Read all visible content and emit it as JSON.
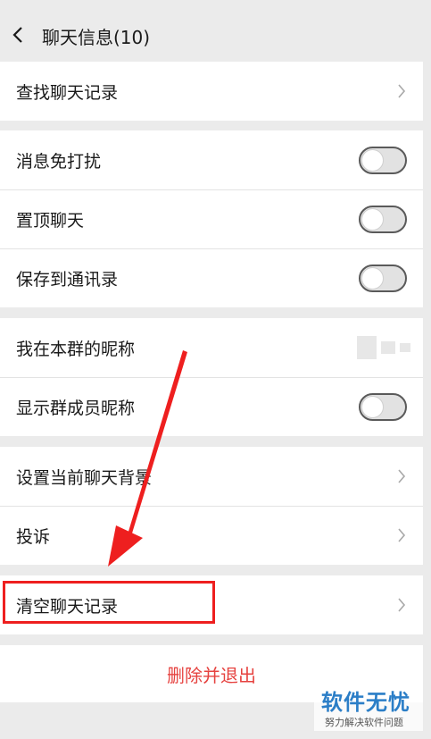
{
  "header": {
    "title": "聊天信息(10)",
    "back_icon": "chevron-left-icon"
  },
  "search_group": {
    "search_history": "查找聊天记录"
  },
  "toggles_group": {
    "mute": "消息免打扰",
    "pin": "置顶聊天",
    "save_contacts": "保存到通讯录"
  },
  "nickname_group": {
    "my_nickname": "我在本群的昵称",
    "show_member_nicknames": "显示群成员昵称"
  },
  "misc_group": {
    "set_background": "设置当前聊天背景",
    "complain": "投诉"
  },
  "clear_group": {
    "clear_history": "清空聊天记录"
  },
  "delete_exit": "删除并退出",
  "watermark": {
    "title": "软件无忧",
    "subtitle": "努力解决软件问题"
  },
  "colors": {
    "danger": "#e64340",
    "annotation": "#ee1f1f",
    "watermark_blue": "#2b7ec7"
  }
}
